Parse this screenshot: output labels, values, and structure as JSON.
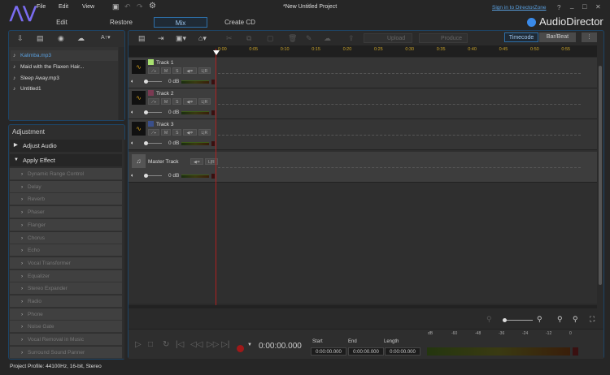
{
  "menu": {
    "file": "File",
    "edit": "Edit",
    "view": "View"
  },
  "title": "*New Untitled Project",
  "sign_in": "Sign in to DirectorZone",
  "window_controls": {
    "help": "?",
    "minimize": "_",
    "maximize": "□",
    "close": "✕"
  },
  "modes": [
    "Edit",
    "Restore",
    "Mix",
    "Create CD"
  ],
  "active_mode": "Mix",
  "brand": "AudioDirector",
  "library": {
    "items": [
      "Kalimba.mp3",
      "Maid with the Flaxen Hair...",
      "Sleep Away.mp3",
      "Untitled1"
    ],
    "selected": "Kalimba.mp3",
    "text_tool": "A↑▾"
  },
  "adjustment": {
    "title": "Adjustment",
    "sections": [
      "Adjust Audio",
      "Apply Effect"
    ],
    "effects": [
      "Dynamic Range Control",
      "Delay",
      "Reverb",
      "Phaser",
      "Flanger",
      "Chorus",
      "Echo",
      "Vocal Transformer",
      "Equalizer",
      "Stereo Expander",
      "Radio",
      "Phone",
      "Noise Gate",
      "Vocal Removal in Music",
      "Surround Sound Panner"
    ]
  },
  "toolbar": {
    "upload": "Upload",
    "produce": "Produce",
    "timecode": "Timecode",
    "barbeat": "Bar/Beat"
  },
  "ruler": [
    "0:00",
    "0:05",
    "0:10",
    "0:15",
    "0:20",
    "0:25",
    "0:30",
    "0:35",
    "0:40",
    "0:45",
    "0:50",
    "0:55"
  ],
  "tracks": [
    {
      "name": "Track 1",
      "color": "#a8e070",
      "volume": "0 dB"
    },
    {
      "name": "Track 2",
      "color": "#7a3a52",
      "volume": "0 dB"
    },
    {
      "name": "Track 3",
      "color": "#3a4f8a",
      "volume": "0 dB"
    }
  ],
  "master": {
    "name": "Master Track",
    "volume": "0 dB"
  },
  "track_buttons": {
    "mute": "M",
    "solo": "S",
    "lr": "L|R"
  },
  "transport": {
    "time": "0:00:00.000",
    "start_label": "Start",
    "start": "0:00:00.000",
    "end_label": "End",
    "end": "0:00:00.000",
    "length_label": "Length",
    "length": "0:00:00.000"
  },
  "meter_scale": [
    "dB",
    "-60",
    "-48",
    "-36",
    "-24",
    "-12",
    "0"
  ],
  "status": "Project Profile: 44100Hz, 16-bit, Stereo"
}
